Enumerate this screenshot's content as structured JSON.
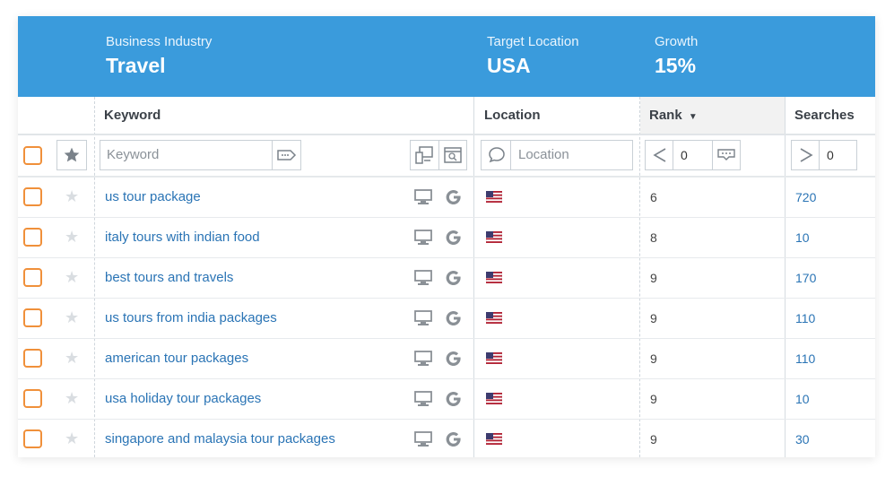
{
  "banner": {
    "industry_label": "Business Industry",
    "industry_value": "Travel",
    "location_label": "Target Location",
    "location_value": "USA",
    "growth_label": "Growth",
    "growth_value": "15%"
  },
  "columns": {
    "keyword": "Keyword",
    "location": "Location",
    "rank": "Rank",
    "searches": "Searches"
  },
  "filters": {
    "keyword_placeholder": "Keyword",
    "location_placeholder": "Location",
    "rank_value": "0",
    "searches_value": "0"
  },
  "colors": {
    "banner": "#3a9bdc",
    "link": "#2a74b5",
    "checkbox": "#f0903a"
  },
  "rows": [
    {
      "keyword": "us tour package",
      "rank": "6",
      "searches": "720"
    },
    {
      "keyword": "italy tours with indian food",
      "rank": "8",
      "searches": "10"
    },
    {
      "keyword": "best tours and travels",
      "rank": "9",
      "searches": "170"
    },
    {
      "keyword": "us tours from india packages",
      "rank": "9",
      "searches": "110"
    },
    {
      "keyword": "american tour packages",
      "rank": "9",
      "searches": "110"
    },
    {
      "keyword": "usa holiday tour packages",
      "rank": "9",
      "searches": "10"
    },
    {
      "keyword": "singapore and malaysia tour packages",
      "rank": "9",
      "searches": "30"
    }
  ]
}
